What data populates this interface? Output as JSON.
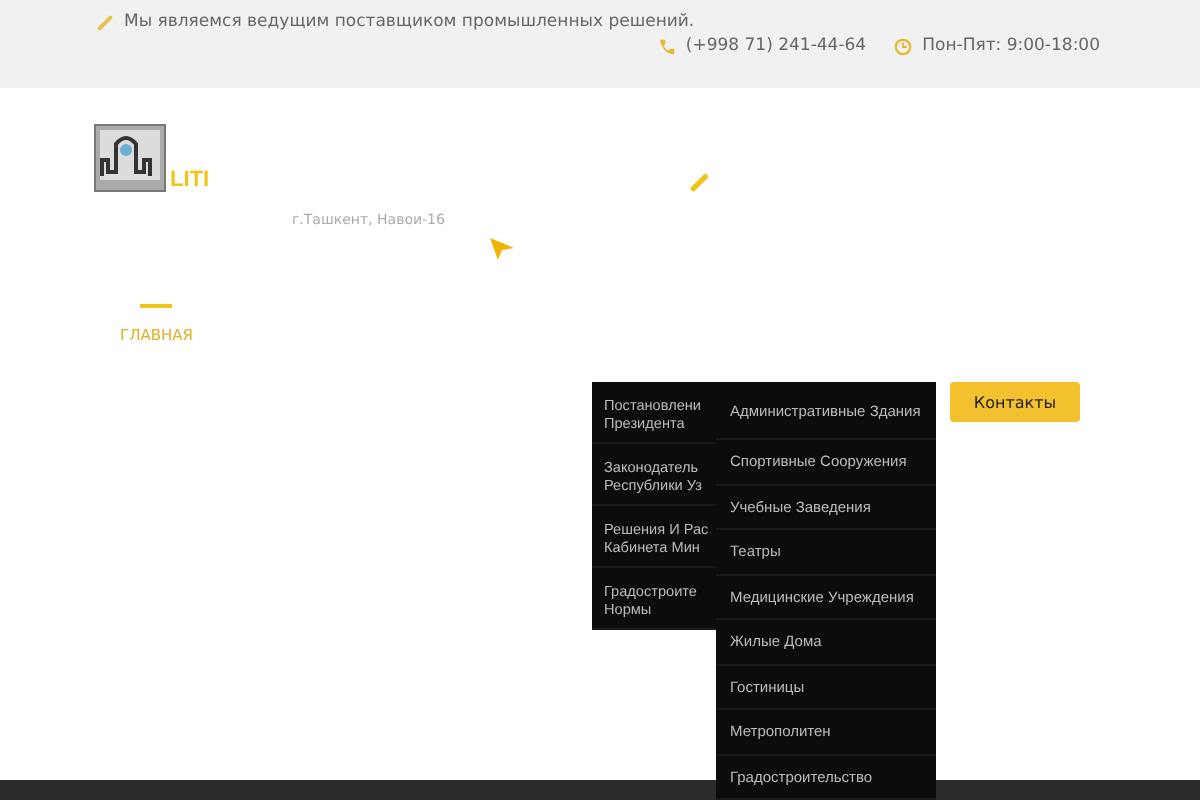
{
  "top_bar": {
    "tagline": "Мы являемся ведущим поставщиком промышленных решений.",
    "phone": "(+998 71) 241-44-64",
    "hours": "Пон-Пят: 9:00-18:00"
  },
  "header": {
    "logo_text": "LITI",
    "address": "г.Ташкент, Навои-16"
  },
  "nav": {
    "items": [
      {
        "label": "ГЛАВНАЯ",
        "selected": true
      }
    ],
    "contact_button": "Контакты"
  },
  "dropdown": {
    "items": [
      {
        "lines": [
          "Постановлени",
          "Президента"
        ]
      },
      {
        "lines": [
          "Законодатель",
          "Республики Уз"
        ]
      },
      {
        "lines": [
          "Решения И Рас",
          "Кабинета Мин"
        ]
      },
      {
        "lines": [
          "Градостроите",
          "Нормы"
        ]
      }
    ]
  },
  "submenu": {
    "items": [
      {
        "label": "Административные Здания"
      },
      {
        "label": "Спортивные Сооружения"
      },
      {
        "label": "Учебные Заведения"
      },
      {
        "label": "Театры"
      },
      {
        "label": "Медицинские Учреждения"
      },
      {
        "label": "Жилые Дома"
      },
      {
        "label": "Гостиницы"
      },
      {
        "label": "Метрополитен"
      },
      {
        "label": "Градостроительство"
      }
    ]
  }
}
